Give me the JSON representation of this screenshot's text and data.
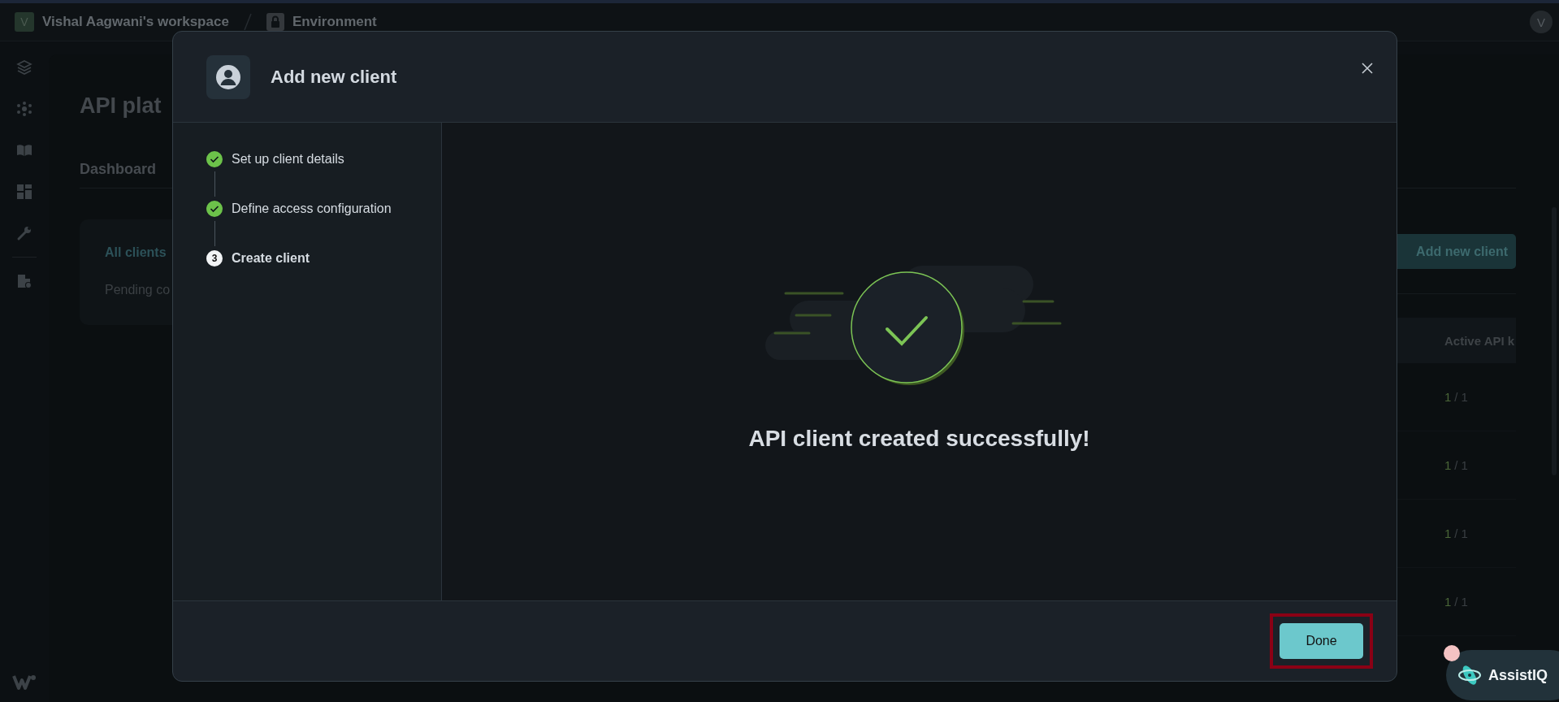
{
  "topbar": {
    "workspace_initial": "V",
    "workspace": "Vishal Aagwani's workspace",
    "environment": "Environment",
    "user_initial": "V"
  },
  "page": {
    "title": "API plat",
    "tab": "Dashboard",
    "filters": [
      {
        "label": "All clients",
        "selected": true
      },
      {
        "label": "Pending co",
        "selected": false
      }
    ],
    "add_button": "Add new client",
    "table": {
      "columns": [
        "Active API k"
      ],
      "rows": [
        {
          "used": "1",
          "sep": "/",
          "limit": "1"
        },
        {
          "used": "1",
          "sep": "/",
          "limit": "1"
        },
        {
          "used": "1",
          "sep": "/",
          "limit": "1"
        },
        {
          "used": "1",
          "sep": "/",
          "limit": "1"
        }
      ]
    }
  },
  "modal": {
    "title": "Add new client",
    "steps": [
      {
        "label": "Set up client details",
        "completed": true
      },
      {
        "label": "Define access configuration",
        "completed": true
      },
      {
        "label": "Create client",
        "completed": false,
        "number": "3"
      }
    ],
    "message": "API client created successfully!",
    "done_button": "Done",
    "highlighted": true
  },
  "assistant": {
    "label": "AssistIQ",
    "notification": true
  }
}
